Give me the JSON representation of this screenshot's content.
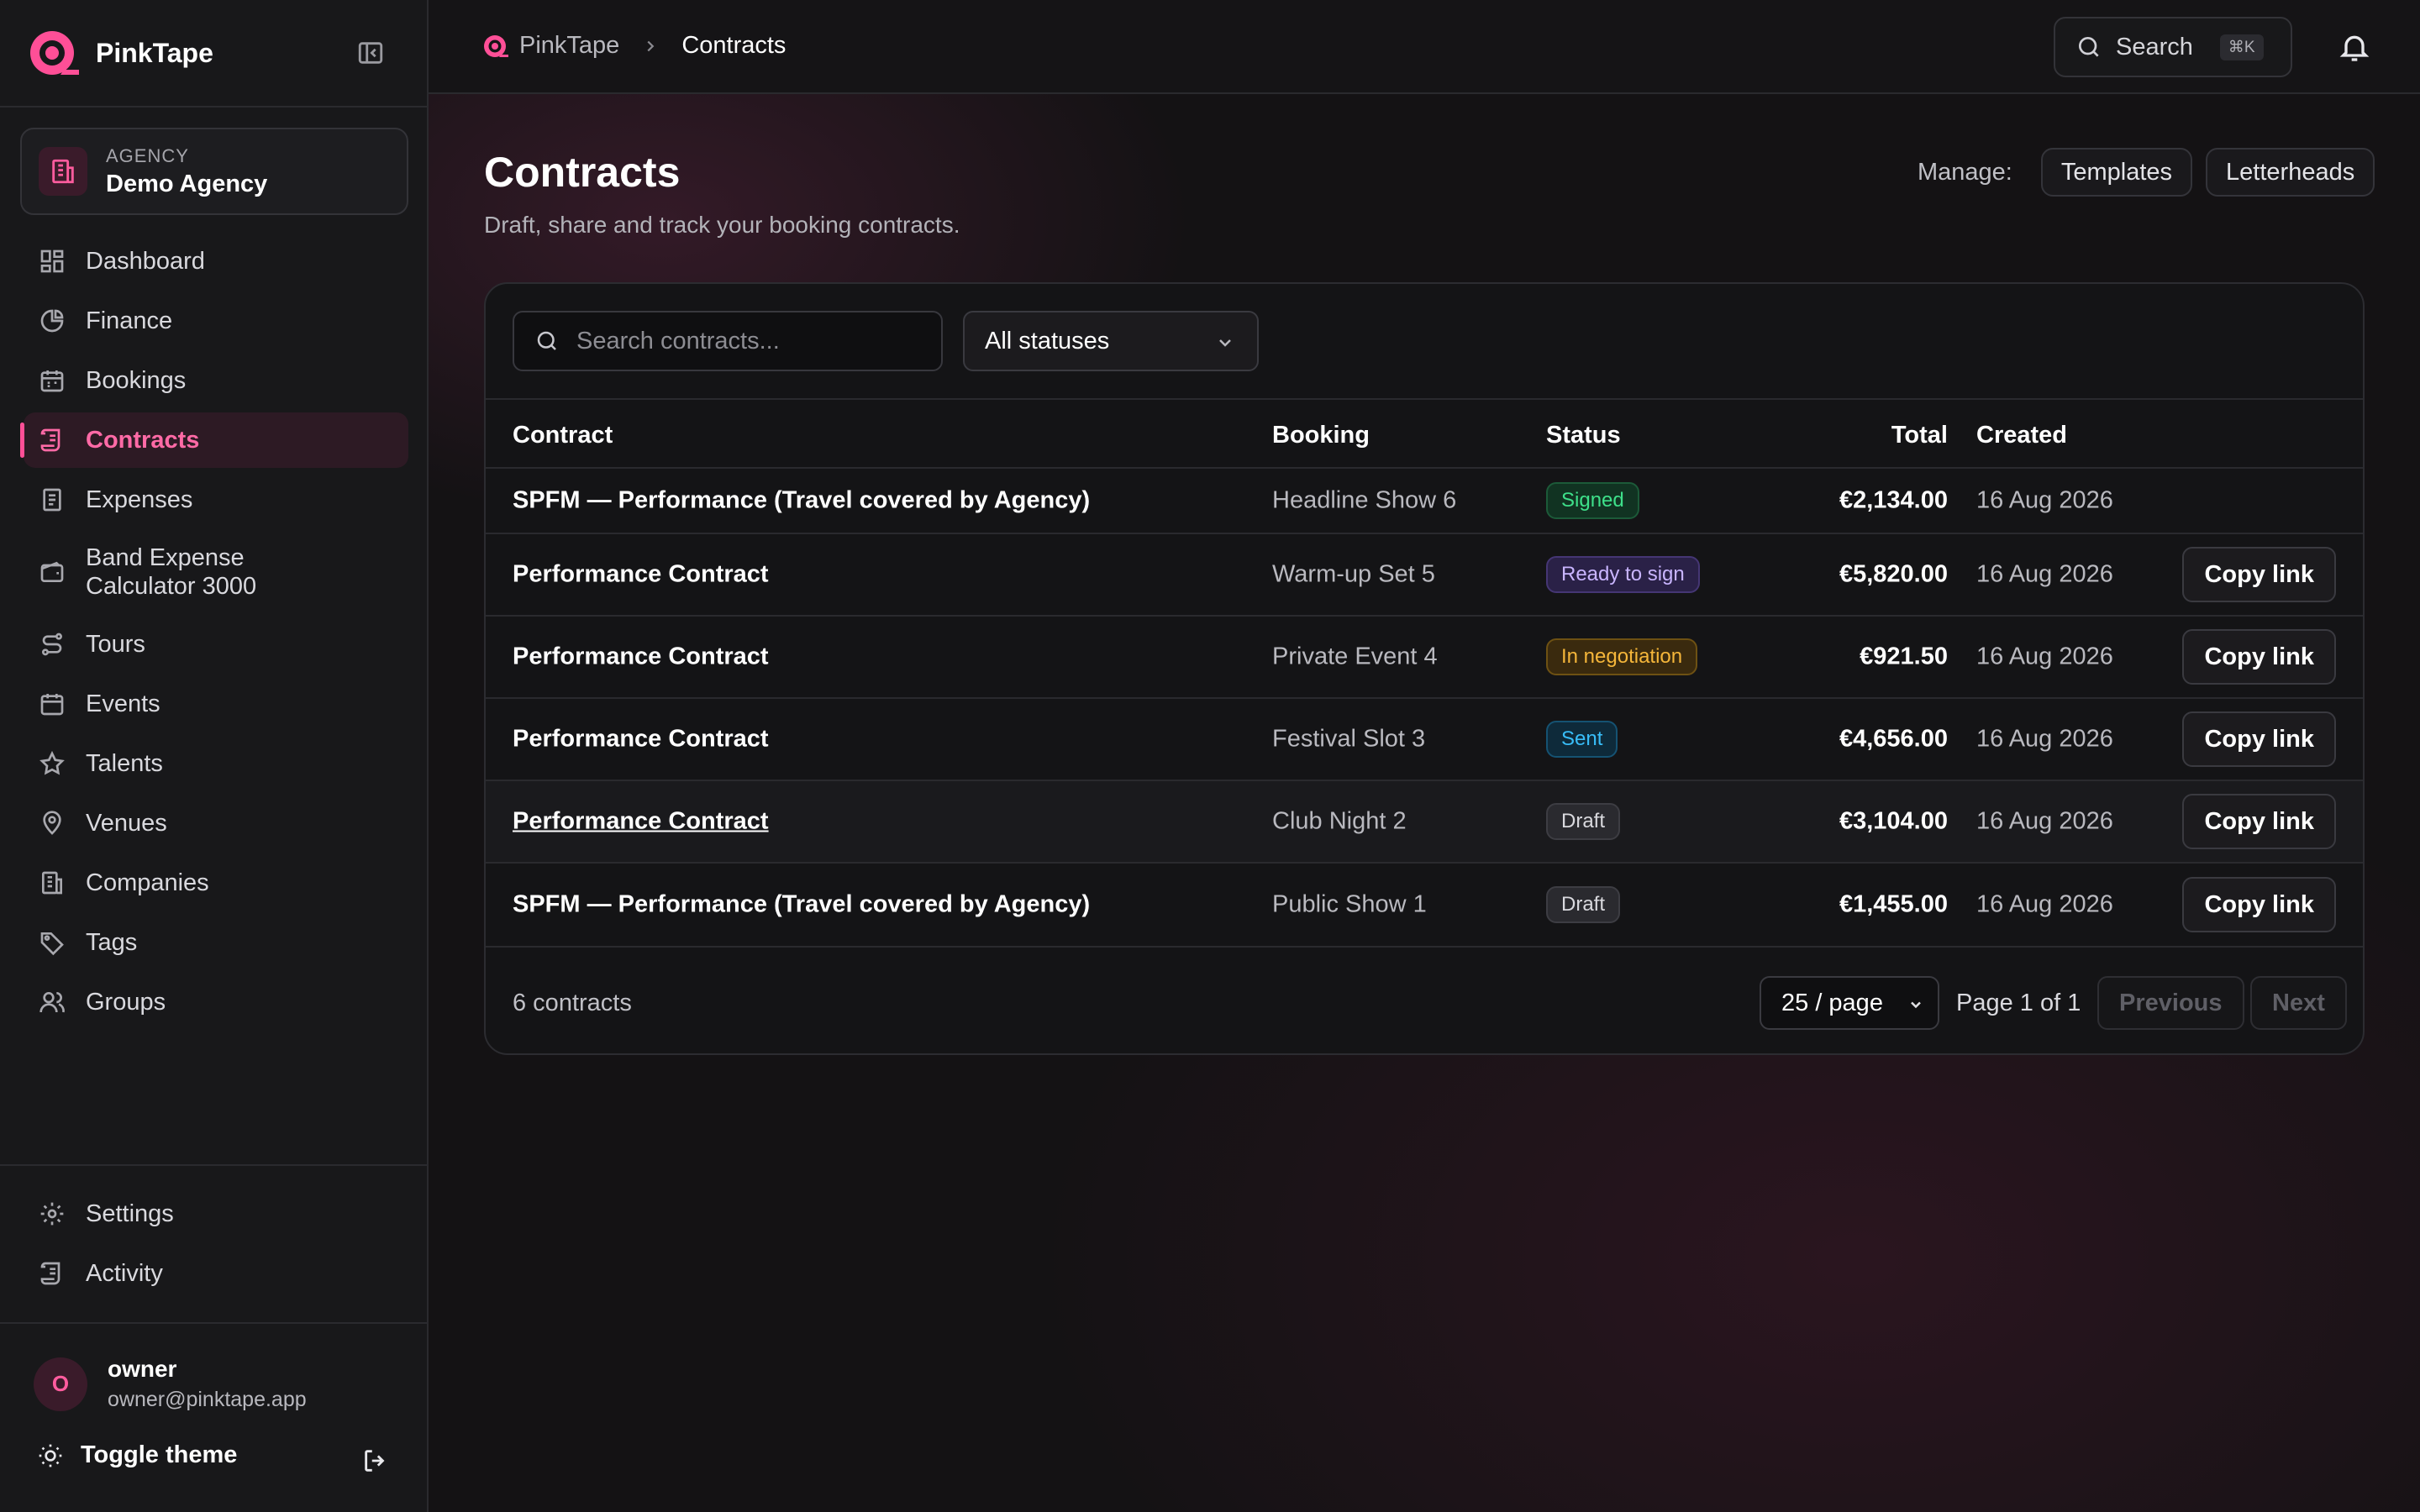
{
  "brand": {
    "name": "PinkTape"
  },
  "agency": {
    "kicker": "AGENCY",
    "name": "Demo Agency"
  },
  "nav": {
    "items": [
      {
        "label": "Dashboard"
      },
      {
        "label": "Finance"
      },
      {
        "label": "Bookings"
      },
      {
        "label": "Contracts"
      },
      {
        "label": "Expenses"
      },
      {
        "label": "Band Expense Calculator 3000"
      },
      {
        "label": "Tours"
      },
      {
        "label": "Events"
      },
      {
        "label": "Talents"
      },
      {
        "label": "Venues"
      },
      {
        "label": "Companies"
      },
      {
        "label": "Tags"
      },
      {
        "label": "Groups"
      }
    ],
    "active": "Contracts",
    "bottom": [
      {
        "label": "Settings"
      },
      {
        "label": "Activity"
      }
    ]
  },
  "user": {
    "initial": "O",
    "name": "owner",
    "email": "owner@pinktape.app",
    "toggle_theme": "Toggle theme"
  },
  "breadcrumb": {
    "home": "PinkTape",
    "current": "Contracts"
  },
  "topbar": {
    "search_label": "Search",
    "search_kbd": "⌘K"
  },
  "page": {
    "title": "Contracts",
    "subtitle": "Draft, share and track your booking contracts.",
    "manage_label": "Manage:",
    "templates": "Templates",
    "letterheads": "Letterheads"
  },
  "filters": {
    "search_placeholder": "Search contracts...",
    "status_value": "All statuses"
  },
  "table": {
    "headers": {
      "contract": "Contract",
      "booking": "Booking",
      "status": "Status",
      "total": "Total",
      "created": "Created"
    },
    "copy_label": "Copy link",
    "rows": [
      {
        "contract": "SPFM — Performance (Travel covered by Agency)",
        "booking": "Headline Show 6",
        "status": "Signed",
        "total": "€2,134.00",
        "created": "16 Aug 2026"
      },
      {
        "contract": "Performance Contract",
        "booking": "Warm-up Set 5",
        "status": "Ready to sign",
        "total": "€5,820.00",
        "created": "16 Aug 2026"
      },
      {
        "contract": "Performance Contract",
        "booking": "Private Event 4",
        "status": "In negotiation",
        "total": "€921.50",
        "created": "16 Aug 2026"
      },
      {
        "contract": "Performance Contract",
        "booking": "Festival Slot 3",
        "status": "Sent",
        "total": "€4,656.00",
        "created": "16 Aug 2026"
      },
      {
        "contract": "Performance Contract",
        "booking": "Club Night 2",
        "status": "Draft",
        "total": "€3,104.00",
        "created": "16 Aug 2026"
      },
      {
        "contract": "SPFM — Performance (Travel covered by Agency)",
        "booking": "Public Show 1",
        "status": "Draft",
        "total": "€1,455.00",
        "created": "16 Aug 2026"
      }
    ]
  },
  "pagination": {
    "count": "6 contracts",
    "per_page": "25 / page",
    "page_info": "Page 1 of 1",
    "previous": "Previous",
    "next": "Next"
  },
  "colors": {
    "accent": "#ff4f97",
    "signed": "#3ee08a",
    "ready": "#c9b5ff",
    "negotiation": "#f5b63a",
    "sent": "#38bdf8"
  }
}
